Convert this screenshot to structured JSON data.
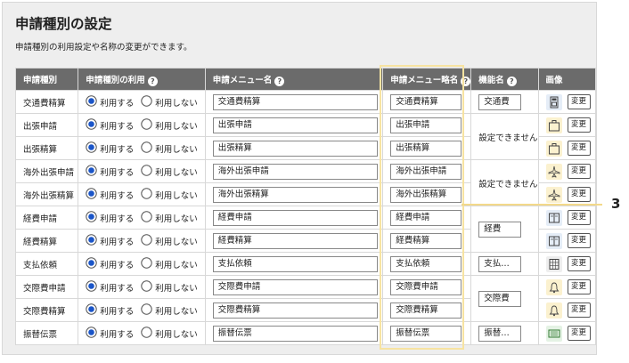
{
  "page": {
    "title": "申請種別の設定",
    "subtitle": "申請種別の利用設定や名称の変更ができます。"
  },
  "headers": [
    "申請種別",
    "申請種別の利用",
    "申請メニュー名",
    "申請メニュー略名",
    "機能名",
    "画像"
  ],
  "help_mark": "?",
  "radio_labels": {
    "use": "利用する",
    "nouse": "利用しない"
  },
  "change_label": "変更",
  "rows": [
    {
      "type": "交通費精算",
      "menu": "交通費精算",
      "short": "交通費精算"
    },
    {
      "type": "出張申請",
      "menu": "出張申請",
      "short": "出張申請"
    },
    {
      "type": "出張精算",
      "menu": "出張精算",
      "short": "出張精算"
    },
    {
      "type": "海外出張申請",
      "menu": "海外出張申請",
      "short": "海外出張申請"
    },
    {
      "type": "海外出張精算",
      "menu": "海外出張精算",
      "short": "海外出張精算"
    },
    {
      "type": "経費申請",
      "menu": "経費申請",
      "short": "経費申請"
    },
    {
      "type": "経費精算",
      "menu": "経費精算",
      "short": "経費精算"
    },
    {
      "type": "支払依頼",
      "menu": "支払依頼",
      "short": "支払依頼"
    },
    {
      "type": "交際費申請",
      "menu": "交際費申請",
      "short": "交際費申請"
    },
    {
      "type": "交際費精算",
      "menu": "交際費精算",
      "short": "交際費精算"
    },
    {
      "type": "振替伝票",
      "menu": "振替伝票",
      "short": "振替伝票"
    }
  ],
  "functions": [
    {
      "text": "交通費",
      "input": true
    },
    {
      "text": "設定できません",
      "input": false
    },
    {
      "text": "設定できません",
      "input": false
    },
    {
      "text": "経費",
      "input": true
    },
    {
      "text": "支払…",
      "input": true
    },
    {
      "text": "交際費",
      "input": true
    },
    {
      "text": "振替…",
      "input": true
    }
  ],
  "icons": [
    "calculator-icon",
    "briefcase-icon",
    "briefcase-icon",
    "airplane-icon",
    "airplane-icon",
    "book-icon",
    "book-icon",
    "grid-table-icon",
    "bell-icon",
    "bell-icon",
    "money-icon"
  ],
  "callout": "3",
  "colors": {
    "header_bg": "#6b6b6b",
    "highlight": "#f7e3a1",
    "radio_selected": "#1a55c8"
  }
}
